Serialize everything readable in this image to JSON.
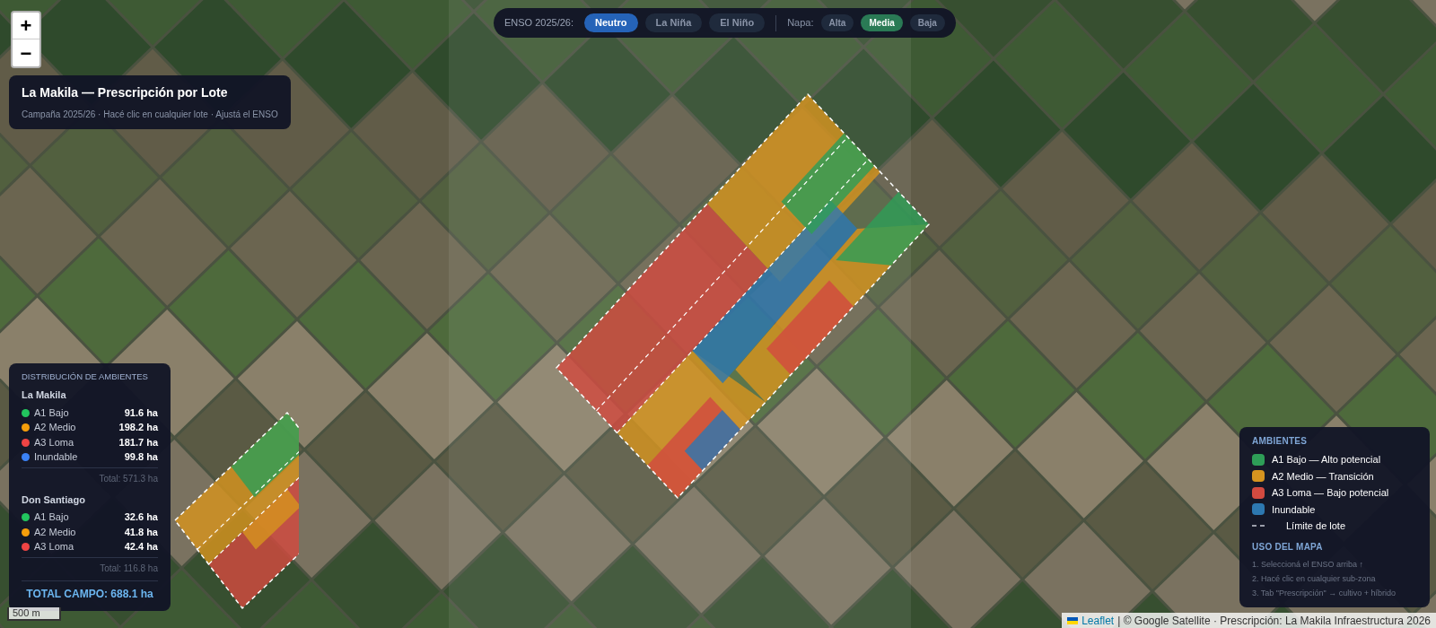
{
  "zoom_controls": [
    "+",
    "−"
  ],
  "enso_bar": {
    "label": "ENSO 2025/26:",
    "options": [
      {
        "label": "Neutro",
        "selected": true
      },
      {
        "label": "La Niña",
        "selected": false
      },
      {
        "label": "El Niño",
        "selected": false
      }
    ],
    "napa_label": "Napa:",
    "napa_options": [
      {
        "label": "Alta",
        "selected": false
      },
      {
        "label": "Media",
        "selected": true
      },
      {
        "label": "Baja",
        "selected": false
      }
    ]
  },
  "title_panel": {
    "title": "La Makila — Prescripción por Lote",
    "subtitle": "Campaña 2025/26 · Hacé clic en cualquier lote · Ajustá el ENSO"
  },
  "distribution": {
    "heading": "DISTRIBUCIÓN DE AMBIENTES",
    "farms": [
      {
        "name": "La Makila",
        "items": [
          {
            "label": "A1 Bajo",
            "value": "91.6 ha",
            "color": "#22c55e"
          },
          {
            "label": "A2 Medio",
            "value": "198.2 ha",
            "color": "#f59e0b"
          },
          {
            "label": "A3 Loma",
            "value": "181.7 ha",
            "color": "#ef4444"
          },
          {
            "label": "Inundable",
            "value": "99.8 ha",
            "color": "#3b82f6"
          }
        ],
        "total": "Total: 571.3 ha"
      },
      {
        "name": "Don Santiago",
        "items": [
          {
            "label": "A1 Bajo",
            "value": "32.6 ha",
            "color": "#22c55e"
          },
          {
            "label": "A2 Medio",
            "value": "41.8 ha",
            "color": "#f59e0b"
          },
          {
            "label": "A3 Loma",
            "value": "42.4 ha",
            "color": "#ef4444"
          }
        ],
        "total": "Total: 116.8 ha"
      }
    ],
    "grand_total": "TOTAL CAMPO: 688.1 ha"
  },
  "legend": {
    "heading": "AMBIENTES",
    "items": [
      {
        "kind": "swatch",
        "label": "A1 Bajo — Alto potencial",
        "color": "#2e9e57"
      },
      {
        "kind": "swatch",
        "label": "A2 Medio — Transición",
        "color": "#d6941f"
      },
      {
        "kind": "swatch",
        "label": "A3 Loma — Bajo potencial",
        "color": "#d24a40"
      },
      {
        "kind": "swatch",
        "label": "Inundable",
        "color": "#2d78b0"
      },
      {
        "kind": "dash",
        "label": "Límite de lote"
      }
    ],
    "usage_heading": "USO DEL MAPA",
    "steps": [
      "1. Seleccioná el ENSO arriba ↑",
      "2. Hacé clic en cualquier sub-zona",
      "3. Tab \"Prescripción\" → cultivo + híbrido"
    ]
  },
  "scale": "500 m",
  "attribution": {
    "link": "Leaflet",
    "text": "| © Google Satellite · Prescripción: La Makila Infraestructura 2026"
  }
}
